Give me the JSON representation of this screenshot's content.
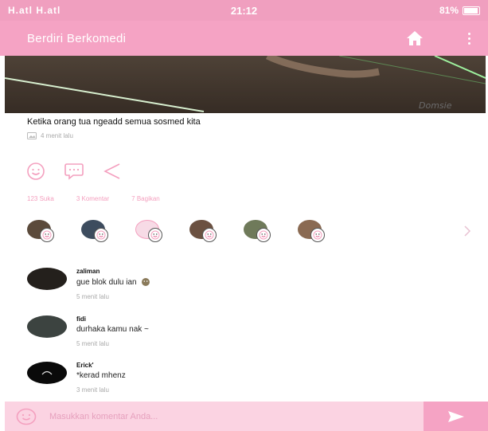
{
  "status_bar": {
    "signal_text": "H.atl H.atl",
    "time": "21:12",
    "battery_text": "81%"
  },
  "app_bar": {
    "title": "Berdiri Berkomedi"
  },
  "post": {
    "title": "Ketika orang tua ngeadd semua sosmed kita",
    "time": "4 menit lalu"
  },
  "stats": {
    "likes": "123 Suka",
    "comments": "3 Komentar",
    "shares": "7 Bagikan"
  },
  "comments": [
    {
      "name": "zaliman",
      "text": "gue blok dulu ian",
      "time": "5 menit lalu"
    },
    {
      "name": "fidi",
      "text": "durhaka kamu nak ~",
      "time": "5 menit lalu"
    },
    {
      "name": "Erick'",
      "text": "*kerad mhenz",
      "time": "3 menit lalu"
    }
  ],
  "composer": {
    "placeholder": "Masukkan komentar Anda..."
  },
  "colors": {
    "primary": "#f5a3c4",
    "status": "#f09fbf",
    "composer_bg": "#fbd3e2",
    "accent_text": "#f4a0bf"
  },
  "icons": {
    "home": "home-icon",
    "more": "more-vert-icon",
    "smile": "smile-icon",
    "comment": "comment-icon",
    "share": "share-icon",
    "send": "send-icon"
  }
}
